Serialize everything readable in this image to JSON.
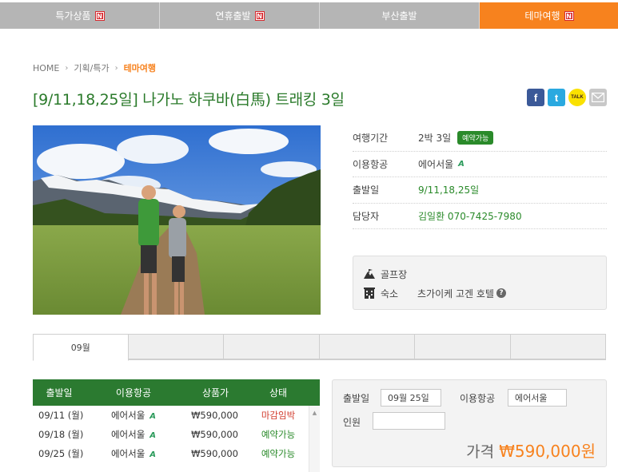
{
  "topnav": [
    {
      "label": "특가상품",
      "badge": "N"
    },
    {
      "label": "연휴출발",
      "badge": "N"
    },
    {
      "label": "부산출발",
      "badge": ""
    },
    {
      "label": "테마여행",
      "badge": "N"
    }
  ],
  "breadcrumb": {
    "home": "HOME",
    "sep": "›",
    "middle": "기획/특가",
    "current": "테마여행"
  },
  "title": "[9/11,18,25일] 나가노 하쿠바(白馬) 트래킹 3일",
  "share": {
    "facebook": "f",
    "twitter": "t",
    "kakaotalk": "TALK",
    "colors": {
      "facebook": "#3b5998",
      "twitter": "#2aa9e0",
      "kakaotalk": "#fae100"
    }
  },
  "info": {
    "period_label": "여행기간",
    "period_value": "2박 3일",
    "period_status": "예약가능",
    "airline_label": "이용항공",
    "airline_value": "에어서울",
    "departure_label": "출발일",
    "departure_value": "9/11,18,25일",
    "manager_label": "담당자",
    "manager_value": "김일환 070-7425-7980"
  },
  "extra": {
    "golf_label": "골프장",
    "golf_value": "",
    "hotel_label": "숙소",
    "hotel_value": "츠가이케 고겐 호텔",
    "help": "?"
  },
  "month_tabs": [
    "09월",
    "",
    "",
    "",
    "",
    ""
  ],
  "schedule": {
    "headers": [
      "출발일",
      "이용항공",
      "상품가",
      "상태"
    ],
    "rows": [
      {
        "date": "09/11 (월)",
        "airline": "에어서울",
        "price": "₩590,000",
        "status": "마감임박",
        "status_color": "#d23c2e"
      },
      {
        "date": "09/18 (월)",
        "airline": "에어서울",
        "price": "₩590,000",
        "status": "예약가능",
        "status_color": "#2a8a2a"
      },
      {
        "date": "09/25 (월)",
        "airline": "에어서울",
        "price": "₩590,000",
        "status": "예약가능",
        "status_color": "#2a8a2a"
      }
    ]
  },
  "booking": {
    "departure_label": "출발일",
    "departure_value": "09월 25일",
    "airline_label": "이용항공",
    "airline_value": "에어서울",
    "people_label": "인원",
    "people_value": "",
    "price_label": "가격",
    "price_value": "₩590,000원"
  },
  "colors": {
    "accent": "#f7821e",
    "green": "#2b7a30",
    "title_green": "#2a7a2a",
    "red": "#d23c2e"
  }
}
